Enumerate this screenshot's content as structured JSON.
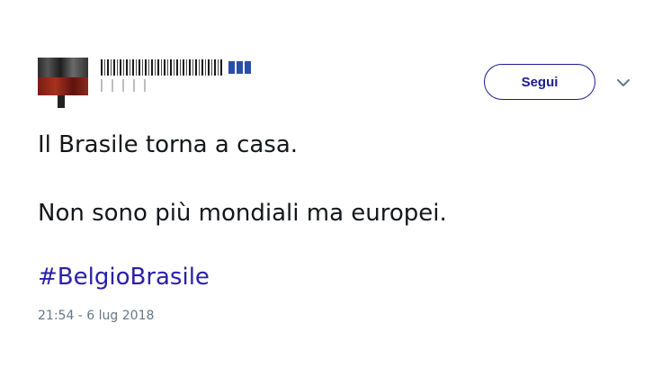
{
  "tweet": {
    "author": {
      "avatar_icon": "profile-avatar",
      "verified_badge_color": "#2a4fa8"
    },
    "follow_label": "Segui",
    "more_icon": "chevron-down-icon",
    "text_lines": [
      "Il Brasile torna a casa.",
      "Non sono più mondiali ma europei."
    ],
    "hashtag": "#BelgioBrasile",
    "timestamp": "21:54 - 6 lug 2018"
  },
  "colors": {
    "accent": "#1b1a8f",
    "link": "#2a1fa8",
    "text": "#14171a",
    "muted": "#657786"
  }
}
